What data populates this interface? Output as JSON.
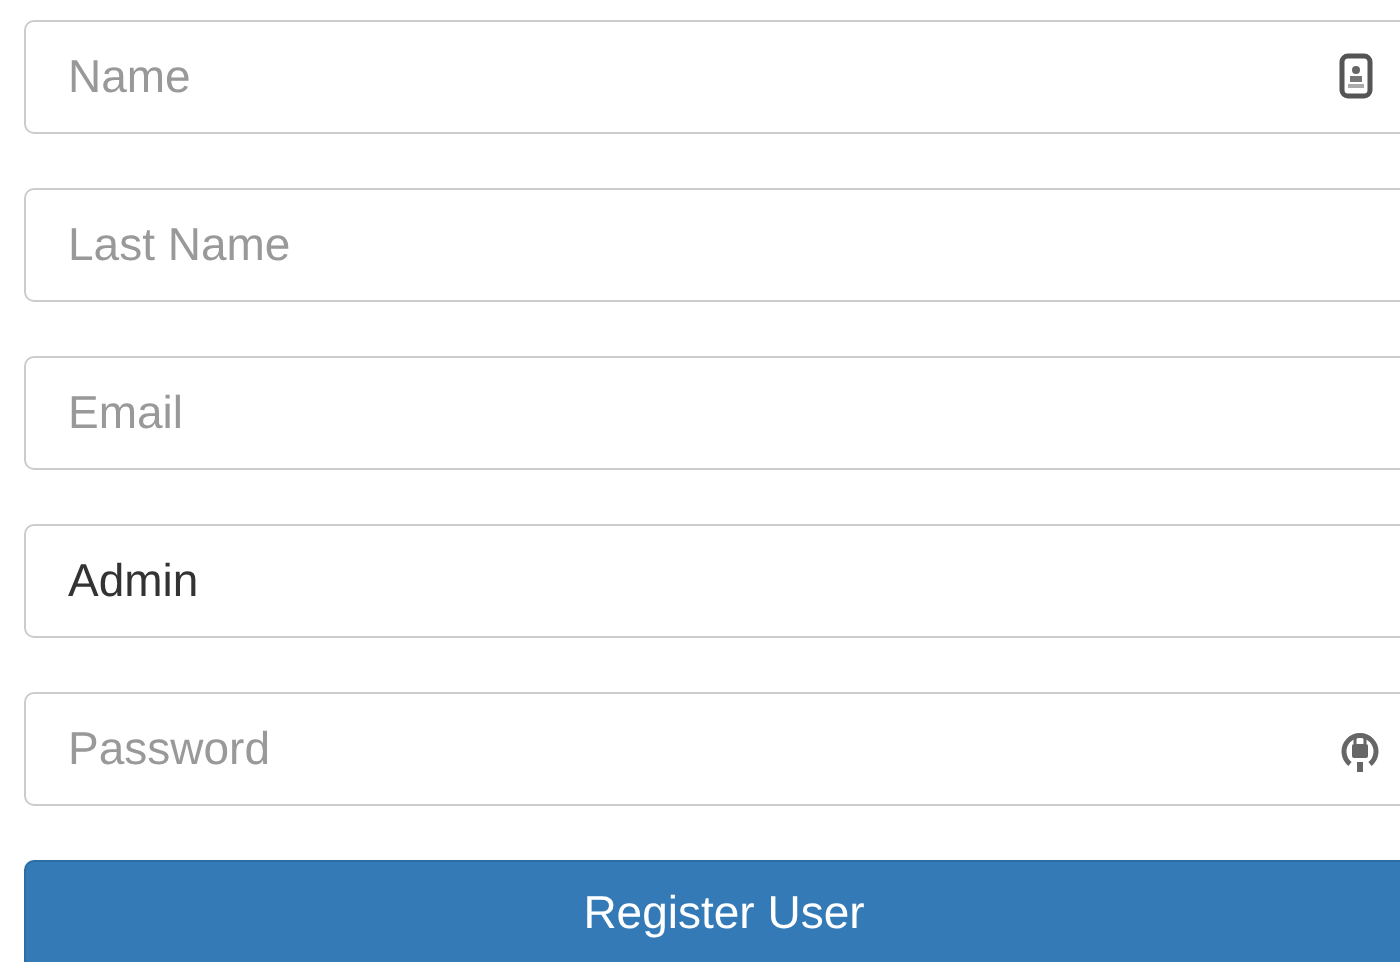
{
  "fields": [
    {
      "kind": "contact",
      "placeholder": "Name"
    },
    {
      "kind": "plain",
      "placeholder": "Last Name"
    },
    {
      "kind": "plain",
      "placeholder": "Email"
    },
    {
      "kind": "plain",
      "value": "Admin"
    },
    {
      "kind": "lock",
      "placeholder": "Password"
    }
  ],
  "button": "Register User"
}
